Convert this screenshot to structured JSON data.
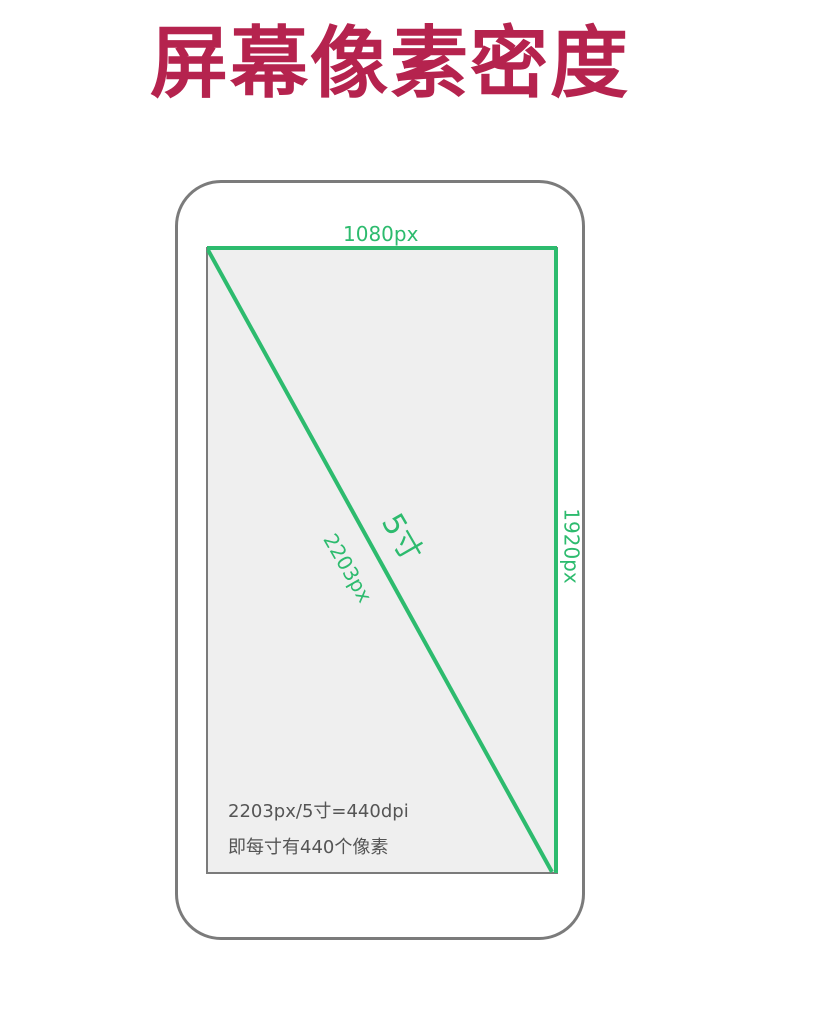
{
  "title": "屏幕像素密度",
  "diagram": {
    "width_label": "1080px",
    "height_label": "1920px",
    "diagonal_size_label": "5寸",
    "diagonal_px_label": "2203px",
    "note_line1": "2203px/5寸=440dpi",
    "note_line2": "即每寸有440个像素"
  },
  "colors": {
    "title": "#b5234e",
    "accent_line": "#2dbb6e",
    "phone_border": "#7b7b7b",
    "screen_fill": "#efefef",
    "note_text": "#555555"
  }
}
